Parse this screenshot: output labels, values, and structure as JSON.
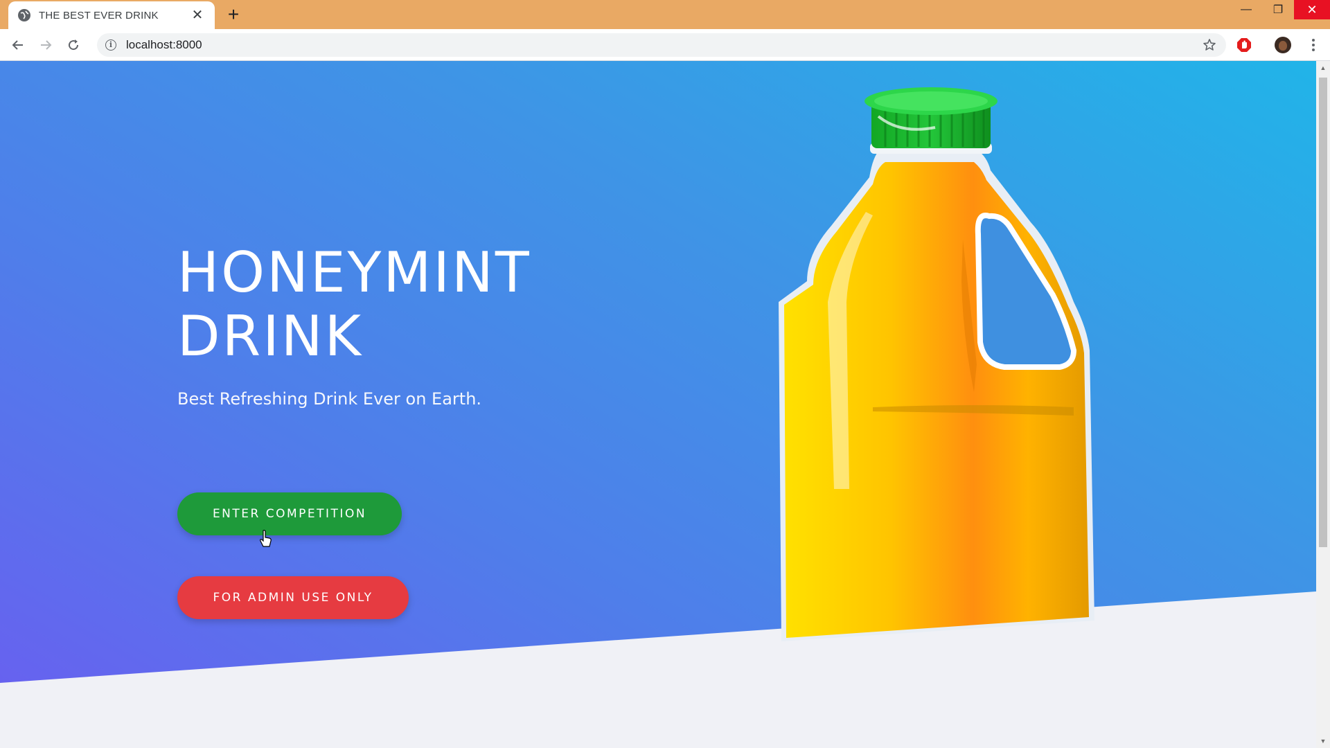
{
  "browser": {
    "tab_title": "THE BEST EVER DRINK",
    "tab_close": "✕",
    "new_tab": "+",
    "url": "localhost:8000",
    "info_glyph": "i",
    "icons": [
      "globe-icon",
      "back-icon",
      "forward-icon",
      "reload-icon",
      "info-icon",
      "star-icon",
      "adblock-icon",
      "avatar",
      "menu-icon",
      "minimize-icon",
      "maximize-icon",
      "close-icon"
    ],
    "window": {
      "minimize": "—",
      "maximize": "❐",
      "close": "✕"
    }
  },
  "hero": {
    "title_line1": "HONEYMINT",
    "title_line2": "DRINK",
    "subtitle": "Best Refreshing Drink Ever on Earth.",
    "enter_button": "ENTER COMPETITION",
    "admin_button": "FOR ADMIN USE ONLY"
  },
  "colors": {
    "titlebar": "#e9a964",
    "hero_gradient": [
      "#6a5ef0",
      "#4f7eea",
      "#3e95e6",
      "#21b4e8"
    ],
    "enter_button": "#1e9a3a",
    "admin_button": "#e63b41",
    "bottle_cap": "#18b52a",
    "bottle_body": "#ffc400"
  }
}
